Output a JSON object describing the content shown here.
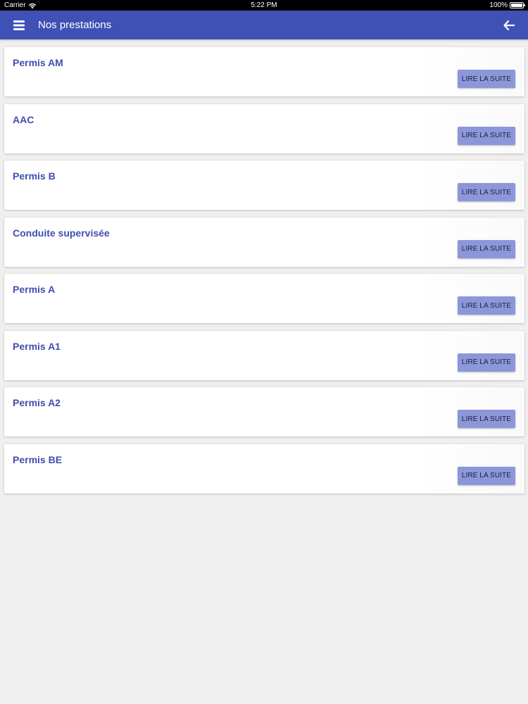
{
  "status_bar": {
    "carrier": "Carrier",
    "time": "5:22 PM",
    "battery": "100%"
  },
  "header": {
    "title": "Nos prestations",
    "menu_icon": "hamburger-icon",
    "back_icon": "arrow-left-icon"
  },
  "colors": {
    "header_bg": "#3f51b5",
    "title_text": "#3f4eae",
    "button_bg": "#8c97d9",
    "page_bg": "#efefef"
  },
  "services": [
    {
      "title": "Permis AM",
      "button_label": "LIRE LA SUITE"
    },
    {
      "title": "AAC",
      "button_label": "LIRE LA SUITE"
    },
    {
      "title": "Permis B",
      "button_label": "LIRE LA SUITE"
    },
    {
      "title": "Conduite supervisée",
      "button_label": "LIRE LA SUITE"
    },
    {
      "title": "Permis A",
      "button_label": "LIRE LA SUITE"
    },
    {
      "title": "Permis A1",
      "button_label": "LIRE LA SUITE"
    },
    {
      "title": "Permis A2",
      "button_label": "LIRE LA SUITE"
    },
    {
      "title": "Permis BE",
      "button_label": "LIRE LA SUITE"
    }
  ]
}
